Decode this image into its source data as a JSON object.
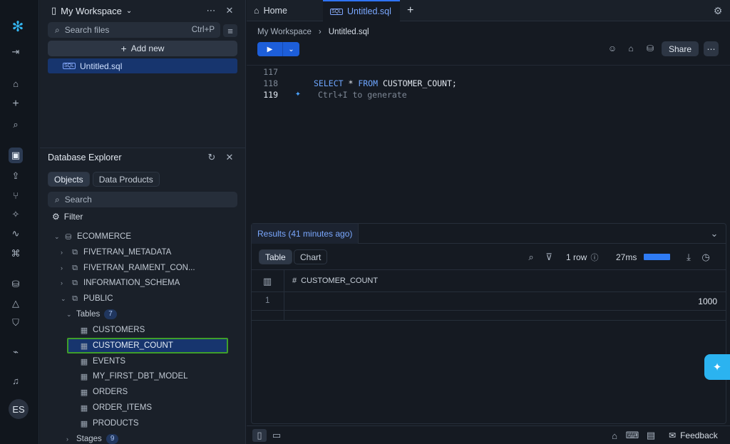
{
  "rail": {
    "icons": [
      "snowflake-logo-icon",
      "collapse-rail-icon",
      "home-icon",
      "plus-icon",
      "search-icon",
      "worksheet-icon",
      "upload-icon",
      "data-flow-icon",
      "ai-sparkles-icon",
      "activity-icon",
      "marketplace-icon",
      "database-icon",
      "triangle-network-icon",
      "shield-icon",
      "monitor-icon",
      "bell-icon"
    ],
    "avatar": "ES"
  },
  "workspace": {
    "title": "My Workspace",
    "search_placeholder": "Search files",
    "search_shortcut": "Ctrl+P",
    "add_new": "Add new",
    "files": [
      {
        "type": "SQL",
        "name": "Untitled.sql"
      }
    ]
  },
  "explorer": {
    "title": "Database Explorer",
    "tabs": [
      "Objects",
      "Data Products"
    ],
    "search_placeholder": "Search",
    "filter": "Filter",
    "database": "ECOMMERCE",
    "schemas": [
      "FIVETRAN_METADATA",
      "FIVETRAN_RAIMENT_CON...",
      "INFORMATION_SCHEMA",
      "PUBLIC"
    ],
    "tables_label": "Tables",
    "tables_count": "7",
    "tables": [
      "CUSTOMERS",
      "CUSTOMER_COUNT",
      "EVENTS",
      "MY_FIRST_DBT_MODEL",
      "ORDERS",
      "ORDER_ITEMS",
      "PRODUCTS"
    ],
    "stages_label": "Stages",
    "stages_count": "9"
  },
  "tabs": {
    "home": "Home",
    "active": "Untitled.sql",
    "active_tag": "SQL"
  },
  "breadcrumb": {
    "root": "My Workspace",
    "current": "Untitled.sql"
  },
  "toolbar": {
    "share": "Share"
  },
  "editor": {
    "lines": [
      {
        "num": "117",
        "text": ""
      },
      {
        "num": "118",
        "kw1": "SELECT",
        "star": " * ",
        "kw2": "FROM",
        "rest": " CUSTOMER_COUNT;"
      },
      {
        "num": "119",
        "hint": "Ctrl+I to generate"
      }
    ]
  },
  "results": {
    "title": "Results (41 minutes ago)",
    "view_tabs": [
      "Table",
      "Chart"
    ],
    "rows": "1 row",
    "duration": "27ms",
    "progress": 1.0,
    "column": "CUSTOMER_COUNT",
    "row_index": "1",
    "value": "1000"
  },
  "footer": {
    "feedback": "Feedback"
  }
}
